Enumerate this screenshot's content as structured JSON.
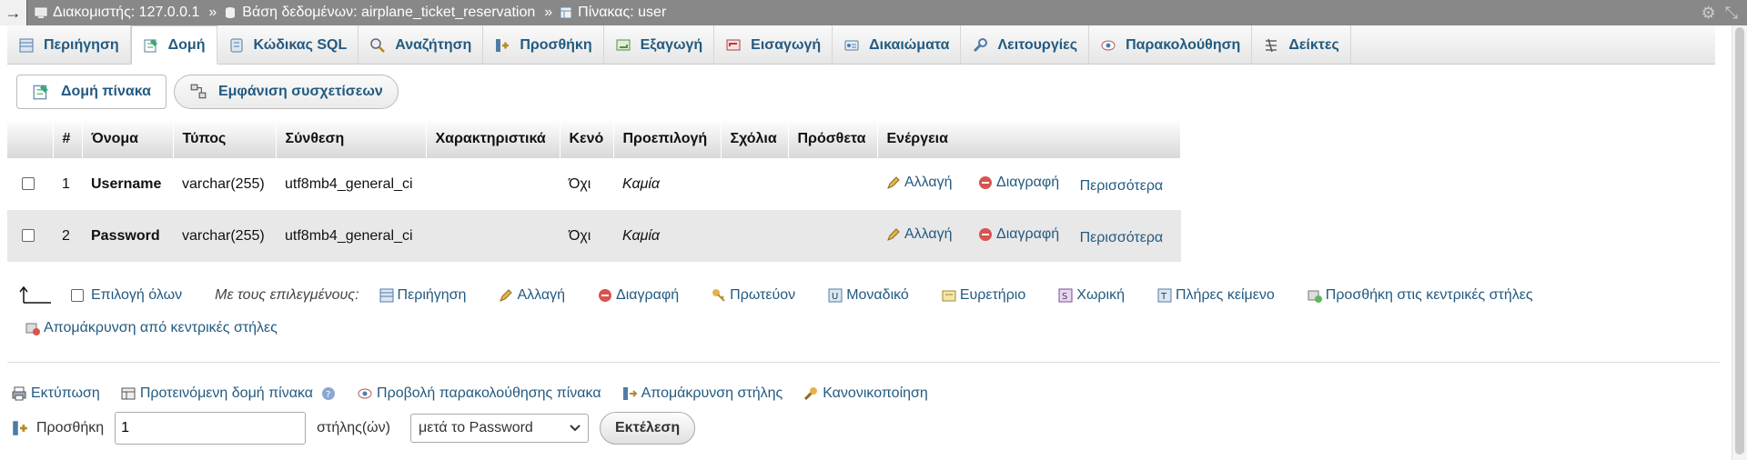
{
  "breadcrumb": {
    "server": "Διακομιστής: 127.0.0.1",
    "database": "Βάση δεδομένων: airplane_ticket_reservation",
    "table": "Πίνακας: user",
    "sep": "»"
  },
  "tabs": [
    {
      "label": "Περιήγηση",
      "icon": "browse-icon"
    },
    {
      "label": "Δομή",
      "icon": "structure-icon",
      "active": true
    },
    {
      "label": "Κώδικας SQL",
      "icon": "sql-icon"
    },
    {
      "label": "Αναζήτηση",
      "icon": "search-icon"
    },
    {
      "label": "Προσθήκη",
      "icon": "insert-icon"
    },
    {
      "label": "Εξαγωγή",
      "icon": "export-icon"
    },
    {
      "label": "Εισαγωγή",
      "icon": "import-icon"
    },
    {
      "label": "Δικαιώματα",
      "icon": "privileges-icon"
    },
    {
      "label": "Λειτουργίες",
      "icon": "operations-icon"
    },
    {
      "label": "Παρακολούθηση",
      "icon": "tracking-icon"
    },
    {
      "label": "Δείκτες",
      "icon": "triggers-icon"
    }
  ],
  "subnav": {
    "table_structure": "Δομή πίνακα",
    "relation_view": "Εμφάνιση συσχετίσεων"
  },
  "table": {
    "headers": [
      "#",
      "Όνομα",
      "Τύπος",
      "Σύνθεση",
      "Χαρακτηριστικά",
      "Κενό",
      "Προεπιλογή",
      "Σχόλια",
      "Πρόσθετα",
      "Ενέργεια"
    ],
    "rows": [
      {
        "num": "1",
        "name": "Username",
        "type": "varchar(255)",
        "collation": "utf8mb4_general_ci",
        "attributes": "",
        "null": "Όχι",
        "default": "Καμία",
        "comments": "",
        "extra": ""
      },
      {
        "num": "2",
        "name": "Password",
        "type": "varchar(255)",
        "collation": "utf8mb4_general_ci",
        "attributes": "",
        "null": "Όχι",
        "default": "Καμία",
        "comments": "",
        "extra": ""
      }
    ],
    "actions": {
      "change": "Αλλαγή",
      "drop": "Διαγραφή",
      "more": "Περισσότερα"
    }
  },
  "bulk": {
    "check_all": "Επιλογή όλων",
    "with_selected": "Με τους επιλεγμένους:",
    "browse": "Περιήγηση",
    "change": "Αλλαγή",
    "drop": "Διαγραφή",
    "primary": "Πρωτεύον",
    "unique": "Μοναδικό",
    "index": "Ευρετήριο",
    "spatial": "Χωρική",
    "fulltext": "Πλήρες κείμενο",
    "add_central": "Προσθήκη στις κεντρικές στήλες",
    "remove_central": "Απομάκρυνση από κεντρικές στήλες"
  },
  "footer": {
    "print": "Εκτύπωση",
    "propose": "Προτεινόμενη δομή πίνακα",
    "track": "Προβολή παρακολούθησης πίνακα",
    "move_columns": "Απομάκρυνση στήλης",
    "normalize": "Κανονικοποίηση"
  },
  "add_columns": {
    "label": "Προσθήκη",
    "count": "1",
    "suffix": "στήλης(ών)",
    "position": "μετά το Password",
    "go": "Εκτέλεση"
  }
}
